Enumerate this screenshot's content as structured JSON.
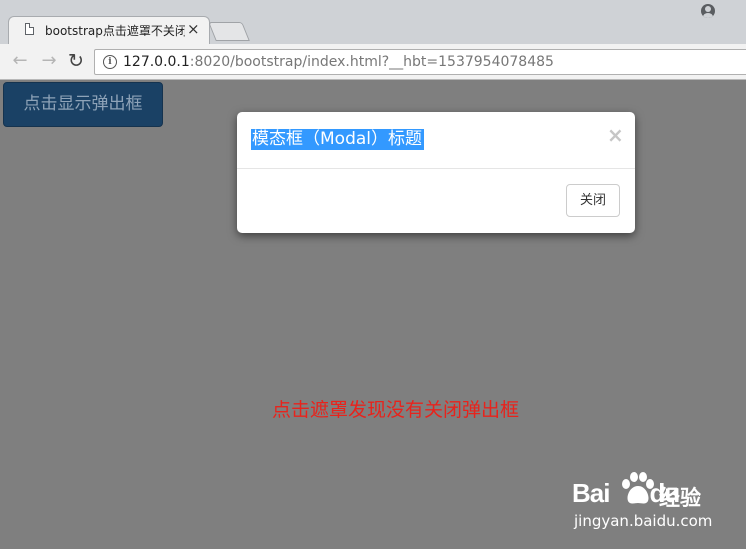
{
  "browser": {
    "tab_title": "bootstrap点击遮罩不关闭",
    "tab_close": "×",
    "url_host": "127.0.0.1",
    "url_rest": ":8020/bootstrap/index.html?__hbt=1537954078485",
    "info_glyph": "i",
    "back_glyph": "←",
    "forward_glyph": "→",
    "reload_glyph": "↻"
  },
  "page": {
    "open_button_label": "点击显示弹出框",
    "mask_note": "点击遮罩发现没有关闭弹出框"
  },
  "modal": {
    "title": "模态框（Modal）标题",
    "close_x": "×",
    "close_button_label": "关闭"
  },
  "watermark": {
    "brand": "Bai",
    "brand_suffix": "du",
    "jingyan": "经验",
    "url": "jingyan.baidu.com"
  },
  "colors": {
    "overlay": "#7f7f7f",
    "primary_button": "#1a4165",
    "title_highlight": "#3399ff",
    "note_text": "#e8231c"
  }
}
